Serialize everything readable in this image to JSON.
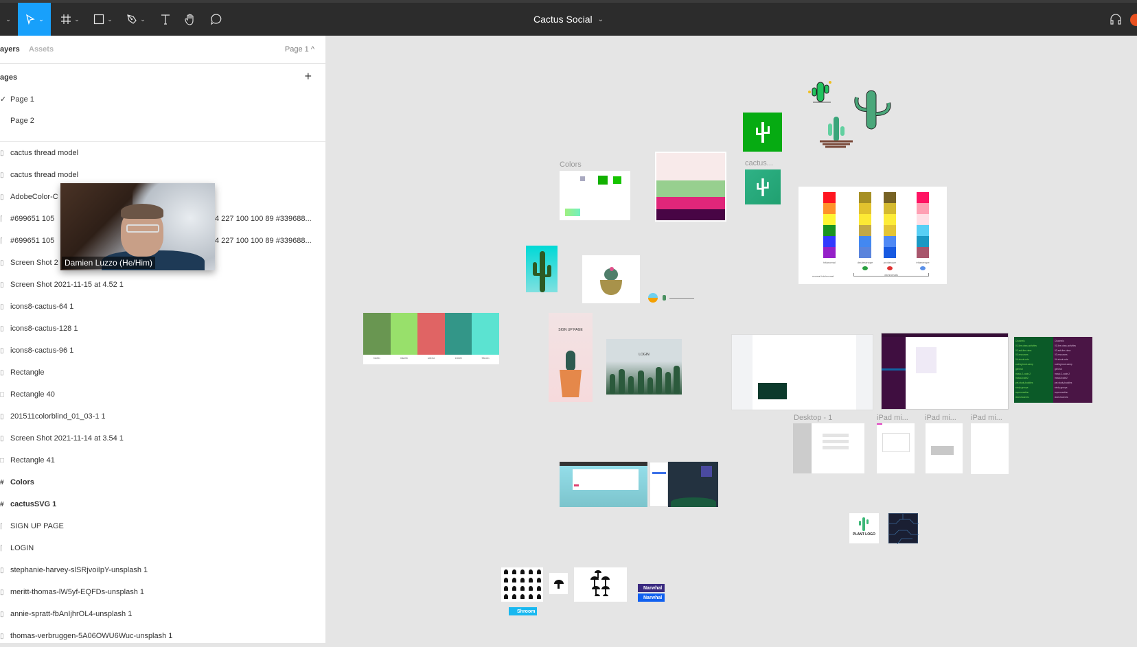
{
  "toolbar": {
    "title": "Cactus Social",
    "title_caret": "⌄",
    "tools": [
      {
        "name": "move-tool",
        "active": true
      },
      {
        "name": "frame-tool"
      },
      {
        "name": "shape-tool"
      },
      {
        "name": "pen-tool"
      },
      {
        "name": "text-tool"
      },
      {
        "name": "hand-tool"
      },
      {
        "name": "comment-tool"
      }
    ],
    "accent": "#18a0fb"
  },
  "panel": {
    "tabs": {
      "layers": "ayers",
      "assets": "Assets"
    },
    "page_switch": "Page 1 ^",
    "pages_title": "ages",
    "add_page": "+",
    "pages": [
      {
        "label": "Page 1",
        "checked": "✓"
      },
      {
        "label": "Page 2",
        "checked": ""
      }
    ],
    "layers": [
      {
        "label": "cactus thread model",
        "type": "image"
      },
      {
        "label": "cactus thread model",
        "type": "image"
      },
      {
        "label": "AdobeColor-C",
        "type": "image"
      },
      {
        "label": "#699651 105",
        "type": "text",
        "suffix": "4 227 100 100 89 #339688..."
      },
      {
        "label": "#699651 105",
        "type": "text",
        "suffix": "4 227 100 100 89 #339688..."
      },
      {
        "label": "Screen Shot 2",
        "type": "image"
      },
      {
        "label": "Screen Shot 2021-11-15 at 4.52 1",
        "type": "image"
      },
      {
        "label": "icons8-cactus-64 1",
        "type": "image"
      },
      {
        "label": "icons8-cactus-128 1",
        "type": "image"
      },
      {
        "label": "icons8-cactus-96 1",
        "type": "image"
      },
      {
        "label": "Rectangle",
        "type": "image"
      },
      {
        "label": "Rectangle 40",
        "type": "rect"
      },
      {
        "label": "201511colorblind_01_03-1 1",
        "type": "image"
      },
      {
        "label": "Screen Shot 2021-11-14 at 3.54 1",
        "type": "image"
      },
      {
        "label": "Rectangle 41",
        "type": "rect"
      },
      {
        "label": "Colors",
        "type": "frame"
      },
      {
        "label": "cactusSVG 1",
        "type": "frame"
      },
      {
        "label": "SIGN UP PAGE",
        "type": "text"
      },
      {
        "label": "LOGIN",
        "type": "text"
      },
      {
        "label": "stephanie-harvey-slSRjvoiIpY-unsplash 1",
        "type": "image"
      },
      {
        "label": "meritt-thomas-lW5yf-EQFDs-unsplash 1",
        "type": "image"
      },
      {
        "label": "annie-spratt-fbAnIjhrOL4-unsplash 1",
        "type": "image"
      },
      {
        "label": "thomas-verbruggen-5A06OWU6Wuc-unsplash 1",
        "type": "image"
      }
    ]
  },
  "video_overlay": {
    "name": "Damien Luzzo (He/Him)"
  },
  "canvas": {
    "frame_labels": {
      "colors": "Colors",
      "cactus": "cactus...",
      "desktop": "Desktop - 1",
      "ipad1": "iPad mi...",
      "ipad2": "iPad mi...",
      "ipad3": "iPad mi..."
    },
    "colors_frame_swatches": [
      "#a9a9c0",
      "#12b000",
      "#16c400",
      "#90f08a"
    ],
    "palette_stack": [
      "#f8eaea",
      "#97cf8f",
      "#e0267a",
      "#480545"
    ],
    "palette_strip": [
      {
        "hex": "#699651",
        "label": "699651"
      },
      {
        "hex": "#98e06b",
        "label": "98E06B"
      },
      {
        "hex": "#e06464",
        "label": "E06464"
      },
      {
        "hex": "#339688",
        "label": "339688"
      },
      {
        "hex": "#5be3d1",
        "label": "5BE3D1"
      }
    ],
    "colorblind": {
      "columns": [
        {
          "label": "tritanomal",
          "colors": [
            "#ff1520",
            "#ff922a",
            "#fff633",
            "#1a9420",
            "#3239ff",
            "#9520c8"
          ]
        },
        {
          "label": "deuteranope",
          "colors": [
            "#a68f24",
            "#e2c22e",
            "#fde935",
            "#c2a847",
            "#4388f1",
            "#5a84dc"
          ]
        },
        {
          "label": "protanope",
          "colors": [
            "#766224",
            "#d5ba2f",
            "#fdec38",
            "#e4c535",
            "#4f89f5",
            "#175ae1"
          ]
        },
        {
          "label": "tritanerope",
          "colors": [
            "#ff1463",
            "#ffa0b4",
            "#ffdfe6",
            "#58cff5",
            "#1a98c4",
            "#a8566c"
          ]
        }
      ],
      "footer_left": "normal trichromat",
      "footer_right": "dichromats"
    },
    "signup_text": "SIGN UP PAGE",
    "login_text": "LOGIN",
    "channels": [
      "Channels",
      "01-live-class-activities",
      "02-ask-the-class",
      "03-resources",
      "04-shout-outs",
      "coding-boot-camp",
      "general",
      "music-2-code-2",
      "music2code2",
      "pet-study-buddies",
      "study-groups",
      "supercreation",
      "Add channels"
    ],
    "plant_logo": "PLANT LOGO",
    "narwhal": "Narwhal",
    "shroom": "Shroom"
  }
}
